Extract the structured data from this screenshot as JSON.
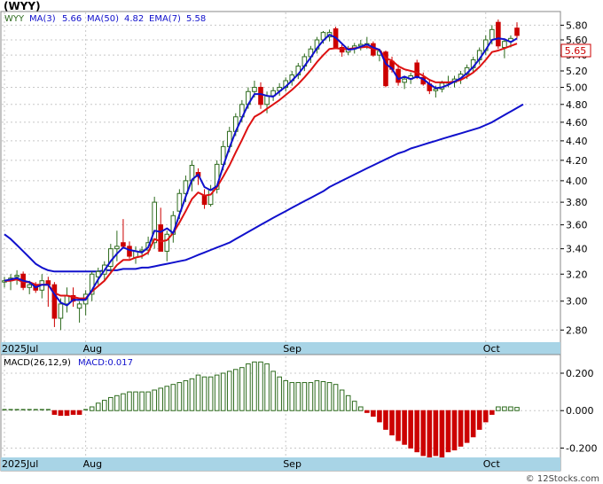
{
  "ticker_title": "(WYY)",
  "legend": {
    "symbol": "WYY",
    "ma3_label": "MA(3)",
    "ma3_value": "5.66",
    "ma50_label": "MA(50)",
    "ma50_value": "4.82",
    "ema7_label": "EMA(7)",
    "ema7_value": "5.58"
  },
  "macd_legend": {
    "label": "MACD(26,12,9)",
    "value_label": "MACD:0.017"
  },
  "watermark": "© 12Stocks.com",
  "last_price_label": "5.65",
  "colors": {
    "up": "#2e6b1e",
    "down": "#cc0000",
    "ma": "#1010cc",
    "ema": "#dd1111",
    "macd": "#2e6b1e",
    "axis_band": "#a8d4e6"
  },
  "chart_data": [
    {
      "type": "candlestick",
      "title": "(WYY)",
      "ylim": [
        2.72,
        5.98
      ],
      "y_scale": "log",
      "y_ticks": [
        2.8,
        3.0,
        3.2,
        3.4,
        3.6,
        3.8,
        4.0,
        4.2,
        4.4,
        4.6,
        4.8,
        5.0,
        5.2,
        5.4,
        5.6,
        5.8
      ],
      "y_tick_labels": [
        "2.80",
        "3.00",
        "3.20",
        "3.40",
        "3.60",
        "3.80",
        "4.00",
        "4.20",
        "4.40",
        "4.60",
        "4.80",
        "5.00",
        "5.20",
        "5.40",
        "5.60",
        "5.80"
      ],
      "x_labels": [
        {
          "index": 0,
          "label": "2025Jul"
        },
        {
          "index": 13,
          "label": "Aug"
        },
        {
          "index": 45,
          "label": "Sep"
        },
        {
          "index": 77,
          "label": "Oct"
        }
      ],
      "grid": true,
      "candles": [
        [
          3.14,
          3.18,
          3.1,
          3.15
        ],
        [
          3.15,
          3.2,
          3.08,
          3.17
        ],
        [
          3.18,
          3.23,
          3.12,
          3.19
        ],
        [
          3.2,
          3.22,
          3.08,
          3.1
        ],
        [
          3.1,
          3.15,
          3.05,
          3.12
        ],
        [
          3.12,
          3.14,
          3.06,
          3.08
        ],
        [
          3.08,
          3.2,
          3.02,
          3.15
        ],
        [
          3.15,
          3.18,
          2.96,
          3.12
        ],
        [
          3.12,
          3.14,
          2.82,
          2.88
        ],
        [
          2.88,
          3.02,
          2.8,
          2.98
        ],
        [
          2.98,
          3.1,
          2.92,
          3.04
        ],
        [
          3.04,
          3.1,
          2.96,
          3.0
        ],
        [
          2.95,
          3.0,
          2.85,
          2.98
        ],
        [
          2.98,
          3.08,
          2.9,
          3.05
        ],
        [
          3.05,
          3.22,
          3.0,
          3.2
        ],
        [
          3.18,
          3.25,
          3.12,
          3.22
        ],
        [
          3.2,
          3.3,
          3.15,
          3.27
        ],
        [
          3.26,
          3.44,
          3.2,
          3.4
        ],
        [
          3.4,
          3.55,
          3.3,
          3.42
        ],
        [
          3.45,
          3.65,
          3.4,
          3.42
        ],
        [
          3.42,
          3.46,
          3.32,
          3.34
        ],
        [
          3.33,
          3.42,
          3.28,
          3.38
        ],
        [
          3.38,
          3.42,
          3.32,
          3.39
        ],
        [
          3.39,
          3.5,
          3.35,
          3.45
        ],
        [
          3.45,
          3.85,
          3.4,
          3.8
        ],
        [
          3.6,
          3.75,
          3.38,
          3.38
        ],
        [
          3.38,
          3.55,
          3.3,
          3.52
        ],
        [
          3.52,
          3.72,
          3.45,
          3.68
        ],
        [
          3.72,
          3.92,
          3.65,
          3.88
        ],
        [
          3.88,
          4.05,
          3.8,
          4.0
        ],
        [
          4.0,
          4.2,
          3.9,
          4.15
        ],
        [
          4.08,
          4.12,
          3.96,
          4.04
        ],
        [
          3.86,
          3.92,
          3.74,
          3.78
        ],
        [
          3.78,
          3.96,
          3.76,
          3.92
        ],
        [
          3.92,
          4.2,
          3.88,
          4.16
        ],
        [
          4.16,
          4.4,
          4.1,
          4.34
        ],
        [
          4.34,
          4.55,
          4.28,
          4.5
        ],
        [
          4.5,
          4.7,
          4.45,
          4.66
        ],
        [
          4.66,
          4.85,
          4.6,
          4.8
        ],
        [
          4.8,
          5.0,
          4.75,
          4.95
        ],
        [
          4.95,
          5.08,
          4.88,
          5.0
        ],
        [
          5.0,
          5.06,
          4.75,
          4.8
        ],
        [
          4.8,
          4.95,
          4.7,
          4.9
        ],
        [
          4.9,
          5.0,
          4.84,
          4.96
        ],
        [
          4.96,
          5.05,
          4.9,
          5.0
        ],
        [
          5.0,
          5.12,
          4.95,
          5.08
        ],
        [
          5.08,
          5.2,
          5.02,
          5.15
        ],
        [
          5.15,
          5.3,
          5.1,
          5.26
        ],
        [
          5.26,
          5.42,
          5.2,
          5.38
        ],
        [
          5.38,
          5.52,
          5.3,
          5.48
        ],
        [
          5.48,
          5.64,
          5.42,
          5.6
        ],
        [
          5.6,
          5.72,
          5.55,
          5.7
        ],
        [
          5.64,
          5.74,
          5.58,
          5.7
        ],
        [
          5.75,
          5.78,
          5.48,
          5.5
        ],
        [
          5.5,
          5.56,
          5.38,
          5.44
        ],
        [
          5.44,
          5.52,
          5.4,
          5.48
        ],
        [
          5.48,
          5.56,
          5.42,
          5.52
        ],
        [
          5.52,
          5.6,
          5.46,
          5.54
        ],
        [
          5.54,
          5.64,
          5.48,
          5.55
        ],
        [
          5.55,
          5.58,
          5.38,
          5.4
        ],
        [
          5.4,
          5.48,
          5.32,
          5.45
        ],
        [
          5.44,
          5.46,
          5.0,
          5.02
        ],
        [
          5.32,
          5.38,
          5.18,
          5.22
        ],
        [
          5.22,
          5.28,
          5.02,
          5.06
        ],
        [
          5.06,
          5.14,
          4.98,
          5.1
        ],
        [
          5.1,
          5.18,
          5.04,
          5.14
        ],
        [
          5.3,
          5.34,
          5.1,
          5.12
        ],
        [
          5.12,
          5.18,
          5.02,
          5.04
        ],
        [
          5.04,
          5.1,
          4.92,
          4.96
        ],
        [
          4.96,
          5.02,
          4.88,
          4.98
        ],
        [
          4.98,
          5.08,
          4.94,
          5.05
        ],
        [
          5.05,
          5.14,
          5.0,
          5.06
        ],
        [
          5.06,
          5.14,
          5.0,
          5.1
        ],
        [
          5.1,
          5.2,
          5.04,
          5.16
        ],
        [
          5.16,
          5.28,
          5.1,
          5.24
        ],
        [
          5.24,
          5.38,
          5.18,
          5.34
        ],
        [
          5.34,
          5.5,
          5.28,
          5.46
        ],
        [
          5.46,
          5.66,
          5.4,
          5.6
        ],
        [
          5.6,
          5.8,
          5.54,
          5.74
        ],
        [
          5.84,
          5.88,
          5.48,
          5.52
        ],
        [
          5.5,
          5.62,
          5.36,
          5.58
        ],
        [
          5.58,
          5.66,
          5.5,
          5.62
        ],
        [
          5.76,
          5.84,
          5.62,
          5.66
        ]
      ],
      "ma3": [
        3.15,
        3.16,
        3.17,
        3.15,
        3.14,
        3.1,
        3.12,
        3.12,
        3.05,
        2.99,
        2.97,
        3.01,
        3.01,
        3.01,
        3.08,
        3.16,
        3.23,
        3.3,
        3.36,
        3.41,
        3.39,
        3.38,
        3.37,
        3.41,
        3.55,
        3.54,
        3.57,
        3.53,
        3.69,
        3.85,
        4.01,
        4.06,
        3.94,
        3.91,
        3.95,
        4.14,
        4.33,
        4.5,
        4.65,
        4.8,
        4.92,
        4.92,
        4.9,
        4.89,
        4.95,
        5.01,
        5.08,
        5.16,
        5.26,
        5.37,
        5.49,
        5.59,
        5.67,
        5.63,
        5.55,
        5.47,
        5.48,
        5.51,
        5.54,
        5.5,
        5.47,
        5.29,
        5.23,
        5.1,
        5.13,
        5.1,
        5.13,
        5.1,
        5.04,
        4.99,
        5.0,
        5.03,
        5.07,
        5.11,
        5.17,
        5.25,
        5.35,
        5.47,
        5.6,
        5.62,
        5.61,
        5.57,
        5.62
      ],
      "ma50": [
        3.52,
        3.48,
        3.43,
        3.38,
        3.33,
        3.28,
        3.25,
        3.23,
        3.22,
        3.22,
        3.22,
        3.22,
        3.22,
        3.22,
        3.22,
        3.22,
        3.23,
        3.23,
        3.23,
        3.24,
        3.24,
        3.24,
        3.25,
        3.25,
        3.26,
        3.27,
        3.28,
        3.29,
        3.3,
        3.31,
        3.33,
        3.35,
        3.37,
        3.39,
        3.41,
        3.43,
        3.45,
        3.48,
        3.51,
        3.54,
        3.57,
        3.6,
        3.63,
        3.66,
        3.69,
        3.72,
        3.75,
        3.78,
        3.81,
        3.84,
        3.87,
        3.9,
        3.94,
        3.97,
        4.0,
        4.03,
        4.06,
        4.09,
        4.12,
        4.15,
        4.18,
        4.21,
        4.24,
        4.27,
        4.29,
        4.32,
        4.34,
        4.36,
        4.38,
        4.4,
        4.42,
        4.44,
        4.46,
        4.48,
        4.5,
        4.52,
        4.54,
        4.57,
        4.6,
        4.64,
        4.68,
        4.72,
        4.76,
        4.8
      ],
      "ema7": [
        3.15,
        3.15,
        3.16,
        3.14,
        3.14,
        3.12,
        3.12,
        3.12,
        3.06,
        3.04,
        3.04,
        3.03,
        3.02,
        3.02,
        3.07,
        3.11,
        3.15,
        3.21,
        3.27,
        3.31,
        3.31,
        3.33,
        3.34,
        3.37,
        3.48,
        3.46,
        3.47,
        3.53,
        3.62,
        3.72,
        3.83,
        3.89,
        3.86,
        3.87,
        3.94,
        4.04,
        4.15,
        4.28,
        4.41,
        4.55,
        4.66,
        4.7,
        4.75,
        4.8,
        4.85,
        4.91,
        4.97,
        5.04,
        5.12,
        5.21,
        5.31,
        5.4,
        5.48,
        5.49,
        5.48,
        5.48,
        5.49,
        5.5,
        5.51,
        5.48,
        5.47,
        5.36,
        5.33,
        5.26,
        5.22,
        5.2,
        5.18,
        5.14,
        5.09,
        5.06,
        5.06,
        5.06,
        5.07,
        5.09,
        5.13,
        5.18,
        5.25,
        5.34,
        5.44,
        5.46,
        5.49,
        5.52,
        5.55
      ]
    },
    {
      "type": "bar",
      "title": "MACD(26,12,9)",
      "ylim": [
        -0.25,
        0.29
      ],
      "y_ticks": [
        -0.2,
        0.0,
        0.2
      ],
      "y_tick_labels": [
        "-0.200",
        "0.000",
        "0.200"
      ],
      "x_labels": [
        {
          "index": 0,
          "label": "2025Jul"
        },
        {
          "index": 13,
          "label": "Aug"
        },
        {
          "index": 45,
          "label": "Sep"
        },
        {
          "index": 77,
          "label": "Oct"
        }
      ],
      "values": [
        0.005,
        0.005,
        0.005,
        0.005,
        0.005,
        0.005,
        0.005,
        0.005,
        -0.02,
        -0.025,
        -0.025,
        -0.02,
        -0.02,
        0.005,
        0.02,
        0.04,
        0.055,
        0.07,
        0.08,
        0.09,
        0.1,
        0.1,
        0.1,
        0.1,
        0.11,
        0.12,
        0.13,
        0.14,
        0.15,
        0.16,
        0.17,
        0.19,
        0.18,
        0.18,
        0.19,
        0.2,
        0.21,
        0.22,
        0.23,
        0.25,
        0.26,
        0.26,
        0.25,
        0.21,
        0.18,
        0.16,
        0.15,
        0.15,
        0.15,
        0.15,
        0.16,
        0.155,
        0.15,
        0.14,
        0.11,
        0.08,
        0.05,
        0.02,
        -0.01,
        -0.03,
        -0.06,
        -0.1,
        -0.13,
        -0.16,
        -0.18,
        -0.2,
        -0.22,
        -0.24,
        -0.25,
        -0.24,
        -0.25,
        -0.22,
        -0.21,
        -0.19,
        -0.17,
        -0.14,
        -0.1,
        -0.06,
        -0.02,
        0.02,
        0.02,
        0.02,
        0.017
      ]
    }
  ]
}
